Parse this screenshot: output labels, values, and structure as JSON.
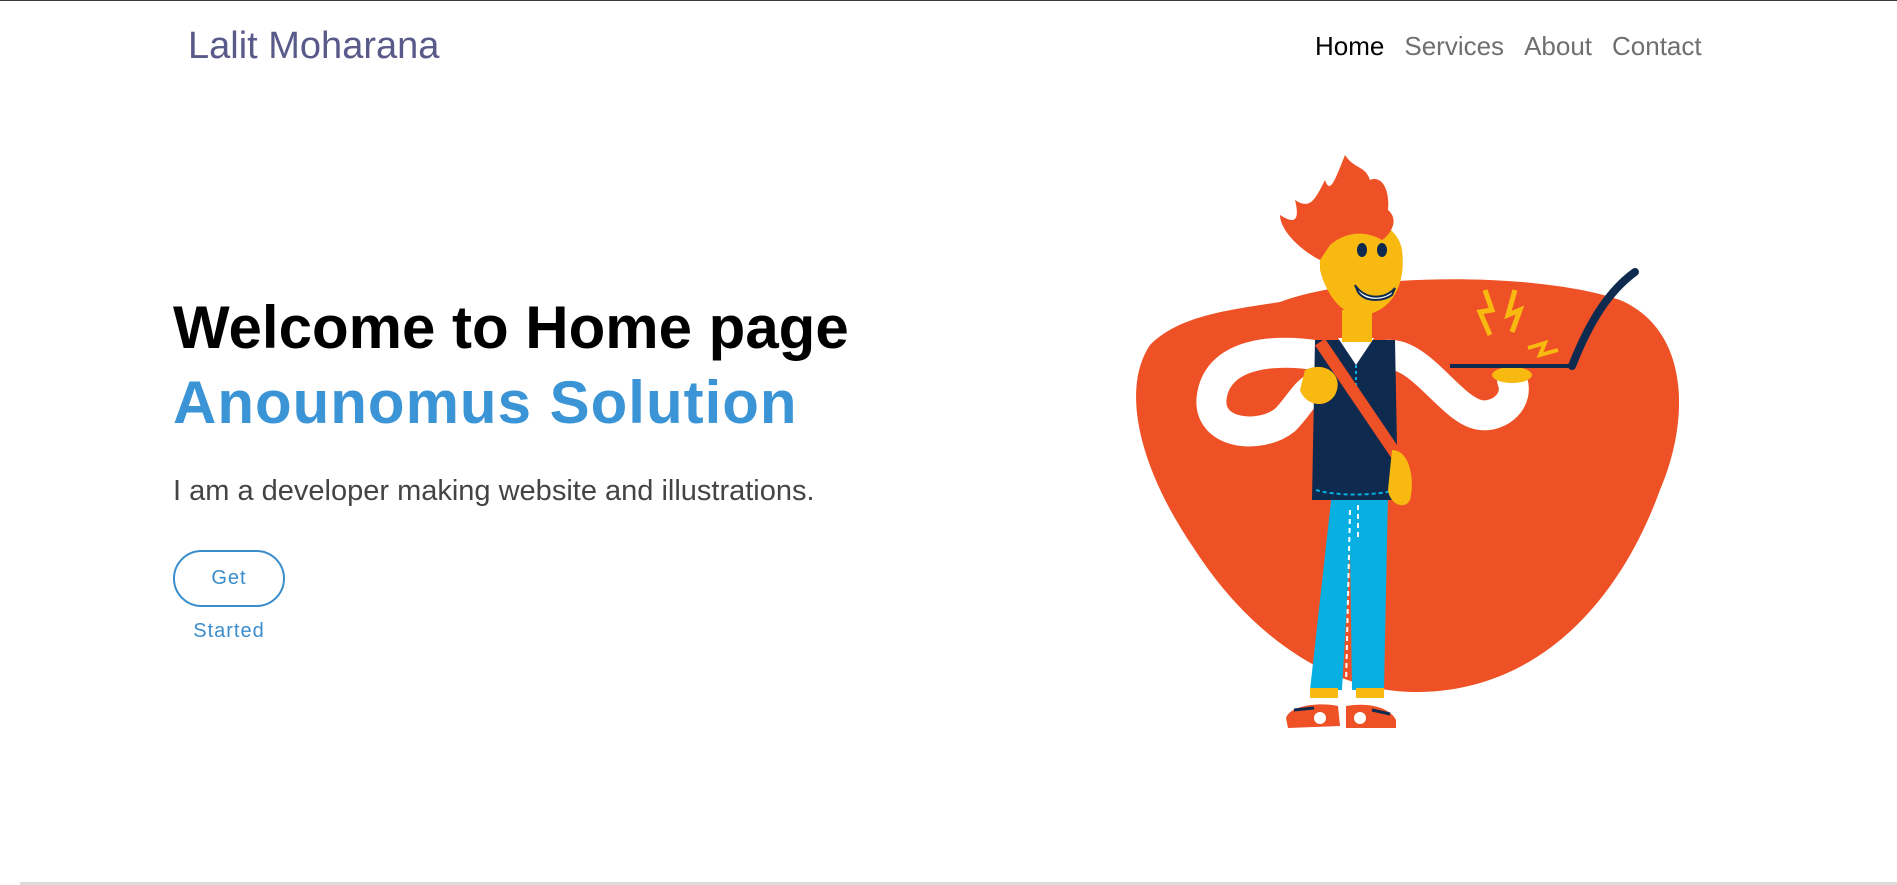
{
  "navbar": {
    "brand": "Lalit Moharana",
    "links": [
      {
        "label": "Home",
        "active": true
      },
      {
        "label": "Services",
        "active": false
      },
      {
        "label": "About",
        "active": false
      },
      {
        "label": "Contact",
        "active": false
      }
    ]
  },
  "hero": {
    "heading": "Welcome to Home page",
    "subheading": "Anounomus Solution",
    "text": "I am a developer making website and illustrations.",
    "cta_label": "Get Started",
    "illustration_icon": "developer-with-laptop-illustration"
  },
  "colors": {
    "accent": "#3a94d6",
    "blob": "#ef5126",
    "brand": "#5a5a8a",
    "nav_inactive": "#6f6f6f",
    "nav_active": "#000000"
  }
}
